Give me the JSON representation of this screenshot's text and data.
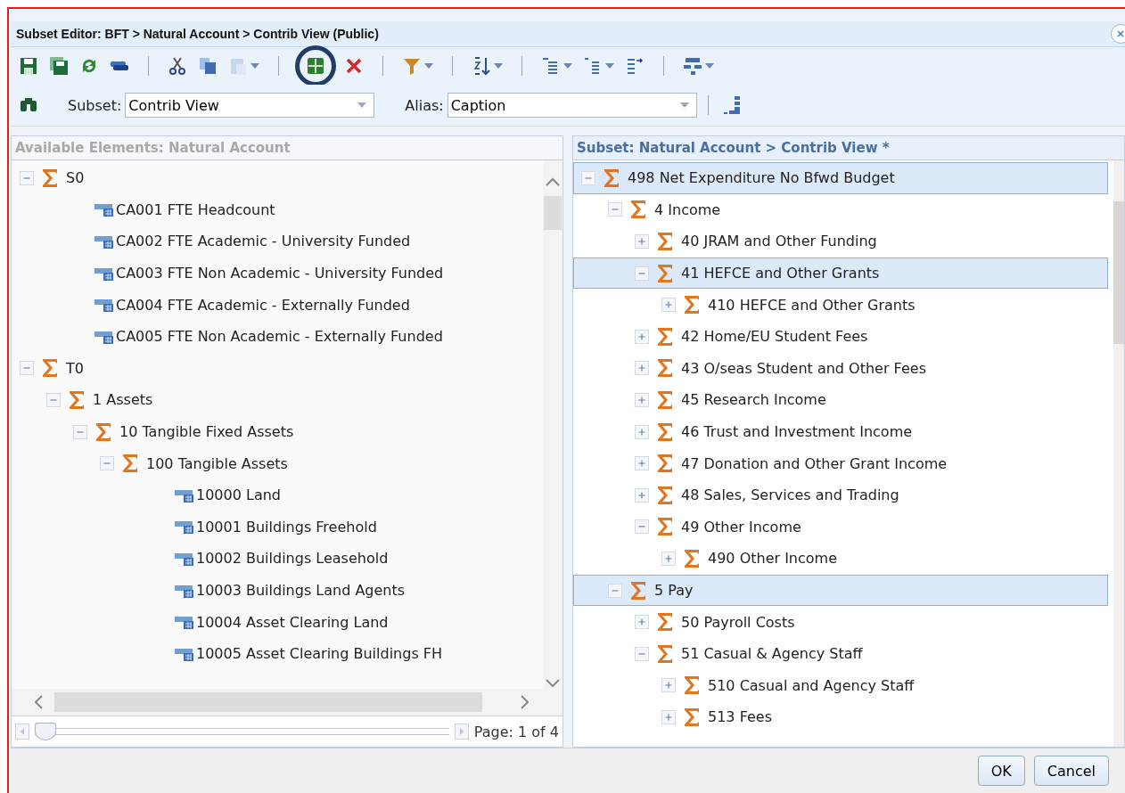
{
  "window": {
    "title": "Subset Editor: BFT > Natural Account > Contrib View (Public)"
  },
  "toolbar": {
    "grid_highlighted": true
  },
  "subset_row": {
    "subset_label": "Subset:",
    "subset_value": "Contrib View",
    "alias_label": "Alias:",
    "alias_value": "Caption"
  },
  "available": {
    "header": "Available Elements: Natural Account",
    "tree": [
      {
        "label": "S0",
        "kind": "consolidated",
        "expanded": true,
        "children": [
          {
            "label": "CA001 FTE Headcount",
            "kind": "leaf"
          },
          {
            "label": "CA002 FTE Academic - University Funded",
            "kind": "leaf"
          },
          {
            "label": "CA003 FTE Non Academic - University Funded",
            "kind": "leaf"
          },
          {
            "label": "CA004 FTE Academic - Externally Funded",
            "kind": "leaf"
          },
          {
            "label": "CA005 FTE Non Academic - Externally Funded",
            "kind": "leaf"
          }
        ]
      },
      {
        "label": "T0",
        "kind": "consolidated",
        "expanded": true,
        "children": [
          {
            "label": "1 Assets",
            "kind": "consolidated",
            "expanded": true,
            "children": [
              {
                "label": "10 Tangible Fixed Assets",
                "kind": "consolidated",
                "expanded": true,
                "children": [
                  {
                    "label": "100 Tangible Assets",
                    "kind": "consolidated",
                    "expanded": true,
                    "children": [
                      {
                        "label": "10000 Land",
                        "kind": "leaf"
                      },
                      {
                        "label": "10001 Buildings Freehold",
                        "kind": "leaf"
                      },
                      {
                        "label": "10002 Buildings Leasehold",
                        "kind": "leaf"
                      },
                      {
                        "label": "10003 Buildings Land Agents",
                        "kind": "leaf"
                      },
                      {
                        "label": "10004 Asset Clearing Land",
                        "kind": "leaf"
                      },
                      {
                        "label": "10005 Asset Clearing Buildings FH",
                        "kind": "leaf"
                      }
                    ]
                  }
                ]
              }
            ]
          }
        ]
      }
    ],
    "pager": {
      "label": "Page: 1 of 4",
      "level": 0
    }
  },
  "subset": {
    "header": "Subset: Natural Account > Contrib View *",
    "tree": [
      {
        "label": "498 Net Expenditure No Bfwd Budget",
        "kind": "consolidated",
        "expanded": true,
        "selected": true,
        "children": [
          {
            "label": "4 Income",
            "kind": "consolidated",
            "expanded": true,
            "selected": false,
            "children": [
              {
                "label": "40 JRAM and Other Funding",
                "kind": "consolidated",
                "expanded": false,
                "selected": false
              },
              {
                "label": "41 HEFCE and Other Grants",
                "kind": "consolidated",
                "expanded": true,
                "selected": true,
                "children": [
                  {
                    "label": "410 HEFCE and Other Grants",
                    "kind": "consolidated",
                    "expanded": false,
                    "selected": false
                  }
                ]
              },
              {
                "label": "42 Home/EU Student Fees",
                "kind": "consolidated",
                "expanded": false,
                "selected": false
              },
              {
                "label": "43 O/seas Student and Other Fees",
                "kind": "consolidated",
                "expanded": false,
                "selected": false
              },
              {
                "label": "45 Research Income",
                "kind": "consolidated",
                "expanded": false,
                "selected": false
              },
              {
                "label": "46 Trust and Investment Income",
                "kind": "consolidated",
                "expanded": false,
                "selected": false
              },
              {
                "label": "47 Donation and Other Grant Income",
                "kind": "consolidated",
                "expanded": false,
                "selected": false
              },
              {
                "label": "48 Sales, Services and Trading",
                "kind": "consolidated",
                "expanded": false,
                "selected": false
              },
              {
                "label": "49 Other Income",
                "kind": "consolidated",
                "expanded": true,
                "selected": false,
                "children": [
                  {
                    "label": "490 Other Income",
                    "kind": "consolidated",
                    "expanded": false,
                    "selected": false
                  }
                ]
              }
            ]
          },
          {
            "label": "5 Pay",
            "kind": "consolidated",
            "expanded": true,
            "selected": true,
            "children": [
              {
                "label": "50 Payroll Costs",
                "kind": "consolidated",
                "expanded": false,
                "selected": false
              },
              {
                "label": "51 Casual & Agency Staff",
                "kind": "consolidated",
                "expanded": true,
                "selected": false,
                "children": [
                  {
                    "label": "510 Casual and Agency Staff",
                    "kind": "consolidated",
                    "expanded": false,
                    "selected": false
                  },
                  {
                    "label": "513 Fees",
                    "kind": "consolidated",
                    "expanded": false,
                    "selected": false
                  }
                ]
              }
            ]
          }
        ]
      }
    ]
  },
  "buttons": [
    "OK",
    "Cancel"
  ]
}
